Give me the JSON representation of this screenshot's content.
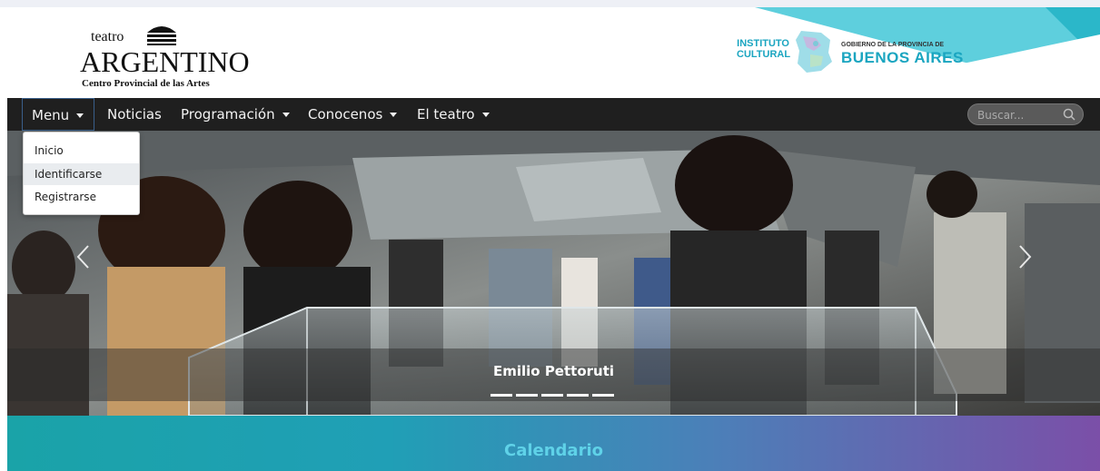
{
  "header": {
    "logo_small": "teatro",
    "logo_main": "ARGENTINO",
    "logo_sub": "Centro Provincial de las Artes",
    "institute_line1": "INSTITUTO",
    "institute_line2": "CULTURAL",
    "gov_line": "GOBIERNO DE LA PROVINCIA DE",
    "gov_name": "BUENOS AIRES"
  },
  "nav": {
    "menu_label": "Menu",
    "items": [
      "Noticias",
      "Programación",
      "Conocenos",
      "El teatro"
    ],
    "search_placeholder": "Buscar..."
  },
  "dropdown": {
    "items": [
      "Inicio",
      "Identificarse",
      "Registrarse"
    ],
    "highlighted": "Identificarse"
  },
  "carousel": {
    "caption": "Emilio Pettoruti",
    "slide_count": 5
  },
  "calendar": {
    "title": "Calendario"
  },
  "colors": {
    "nav_bg": "#1f1f1f",
    "accent": "#1aa5c0",
    "calendar_title": "#5fd2e8"
  },
  "icons": {
    "search": "search-icon",
    "prev": "chevron-left-icon",
    "next": "chevron-right-icon",
    "caret": "caret-down-icon"
  }
}
